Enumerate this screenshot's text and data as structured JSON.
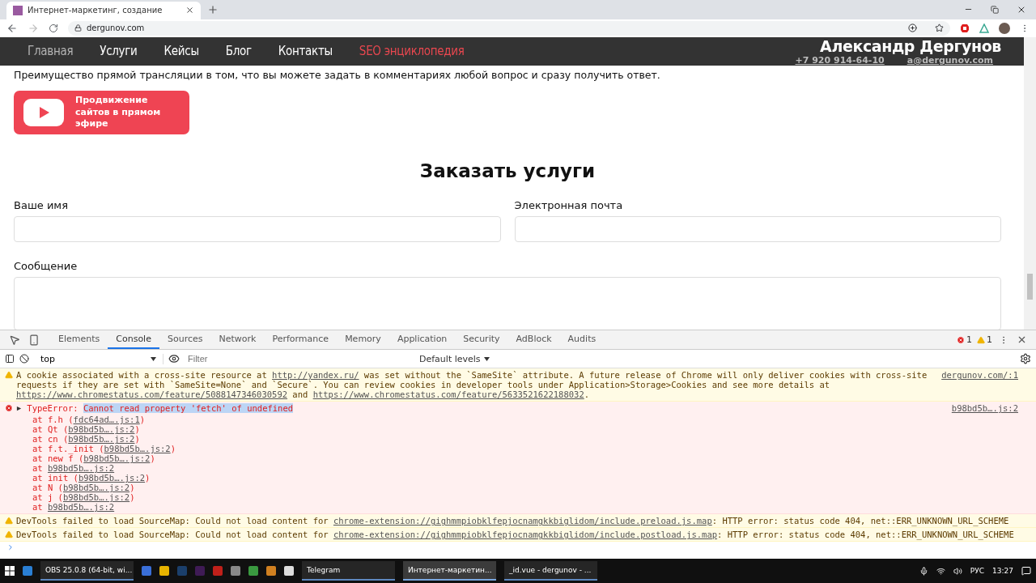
{
  "browser": {
    "tab_title": "Интернет-маркетинг, создание",
    "url": "dergunov.com"
  },
  "site": {
    "nav": [
      {
        "label": "Главная",
        "color": "#b4b4b4"
      },
      {
        "label": "Услуги",
        "color": "#ffffff"
      },
      {
        "label": "Кейсы",
        "color": "#ffffff"
      },
      {
        "label": "Блог",
        "color": "#ffffff"
      },
      {
        "label": "Контакты",
        "color": "#ffffff"
      },
      {
        "label": "SEO энциклопедия",
        "color": "#e8474f"
      }
    ],
    "owner": "Александр Дергунов",
    "phone": "+7 920 914-64-10",
    "email": "a@dergunov.com",
    "paragraph": "Преимущество прямой трансляции в том, что вы можете задать в комментариях любой вопрос и сразу получить ответ.",
    "live_button": "Продвижение сайтов в прямом эфире",
    "form": {
      "title": "Заказать услуги",
      "fields": [
        {
          "label": "Ваше имя"
        },
        {
          "label": "Электронная почта"
        }
      ],
      "message_label": "Сообщение"
    }
  },
  "devtools": {
    "tabs": [
      {
        "label": "Elements",
        "selected": false
      },
      {
        "label": "Console",
        "selected": true
      },
      {
        "label": "Sources",
        "selected": false
      },
      {
        "label": "Network",
        "selected": false
      },
      {
        "label": "Performance",
        "selected": false
      },
      {
        "label": "Memory",
        "selected": false
      },
      {
        "label": "Application",
        "selected": false
      },
      {
        "label": "Security",
        "selected": false
      },
      {
        "label": "AdBlock",
        "selected": false
      },
      {
        "label": "Audits",
        "selected": false
      }
    ],
    "error_count": "1",
    "warning_count": "1",
    "context": "top",
    "filter_placeholder": "Filter",
    "levels": "Default levels",
    "messages": [
      {
        "kind": "warning",
        "segments": [
          {
            "text": "A cookie associated with a cross-site resource at ",
            "link": false
          },
          {
            "text": "http://yandex.ru/",
            "link": true
          },
          {
            "text": " was set without the `SameSite` attribute. A future release of Chrome will only deliver cookies with cross-site requests if they are set with `SameSite=None` and `Secure`. You can review cookies in developer tools under Application>Storage>Cookies and see more details at ",
            "link": false
          },
          {
            "text": "https://www.chromestatus.com/feature/5088147346030592",
            "link": true
          },
          {
            "text": " and ",
            "link": false
          },
          {
            "text": "https://www.chromestatus.com/feature/5633521622188032",
            "link": true
          },
          {
            "text": ".",
            "link": false
          }
        ],
        "source": "dergunov.com/:1"
      },
      {
        "kind": "error",
        "expanded": true,
        "prefix": "TypeError: ",
        "highlight": "Cannot read property 'fetch' of undefined",
        "source": "b98bd5b….js:2",
        "stack": [
          [
            {
              "text": "at f.h (",
              "link": false
            },
            {
              "text": "fdc64ad….js:1",
              "link": true
            },
            {
              "text": ")",
              "link": false
            }
          ],
          [
            {
              "text": "at Qt (",
              "link": false
            },
            {
              "text": "b98bd5b….js:2",
              "link": true
            },
            {
              "text": ")",
              "link": false
            }
          ],
          [
            {
              "text": "at cn (",
              "link": false
            },
            {
              "text": "b98bd5b….js:2",
              "link": true
            },
            {
              "text": ")",
              "link": false
            }
          ],
          [
            {
              "text": "at f.t._init (",
              "link": false
            },
            {
              "text": "b98bd5b….js:2",
              "link": true
            },
            {
              "text": ")",
              "link": false
            }
          ],
          [
            {
              "text": "at new f (",
              "link": false
            },
            {
              "text": "b98bd5b….js:2",
              "link": true
            },
            {
              "text": ")",
              "link": false
            }
          ],
          [
            {
              "text": "at ",
              "link": false
            },
            {
              "text": "b98bd5b….js:2",
              "link": true
            }
          ],
          [
            {
              "text": "at init (",
              "link": false
            },
            {
              "text": "b98bd5b….js:2",
              "link": true
            },
            {
              "text": ")",
              "link": false
            }
          ],
          [
            {
              "text": "at N (",
              "link": false
            },
            {
              "text": "b98bd5b….js:2",
              "link": true
            },
            {
              "text": ")",
              "link": false
            }
          ],
          [
            {
              "text": "at j (",
              "link": false
            },
            {
              "text": "b98bd5b….js:2",
              "link": true
            },
            {
              "text": ")",
              "link": false
            }
          ],
          [
            {
              "text": "at ",
              "link": false
            },
            {
              "text": "b98bd5b….js:2",
              "link": true
            }
          ]
        ]
      },
      {
        "kind": "warning",
        "segments": [
          {
            "text": "DevTools failed to load SourceMap: Could not load content for ",
            "link": false
          },
          {
            "text": "chrome-extension://gighmmpiobklfepjocnamgkkbiglidom/include.preload.js.map",
            "link": true
          },
          {
            "text": ": HTTP error: status code 404, net::ERR_UNKNOWN_URL_SCHEME",
            "link": false
          }
        ]
      },
      {
        "kind": "warning",
        "segments": [
          {
            "text": "DevTools failed to load SourceMap: Could not load content for ",
            "link": false
          },
          {
            "text": "chrome-extension://gighmmpiobklfepjocnamgkkbiglidom/include.postload.js.map",
            "link": true
          },
          {
            "text": ": HTTP error: status code 404, net::ERR_UNKNOWN_URL_SCHEME",
            "link": false
          }
        ]
      }
    ]
  },
  "taskbar": {
    "apps": [
      {
        "label": "OBS 25.0.8 (64-bit, wi...",
        "selected": false
      },
      {
        "label": "Telegram",
        "selected": false
      },
      {
        "label": "Интернет-маркетин...",
        "selected": true
      },
      {
        "label": "_id.vue - dergunov - ...",
        "selected": false
      }
    ],
    "language": "РУС",
    "time": "13:27"
  }
}
